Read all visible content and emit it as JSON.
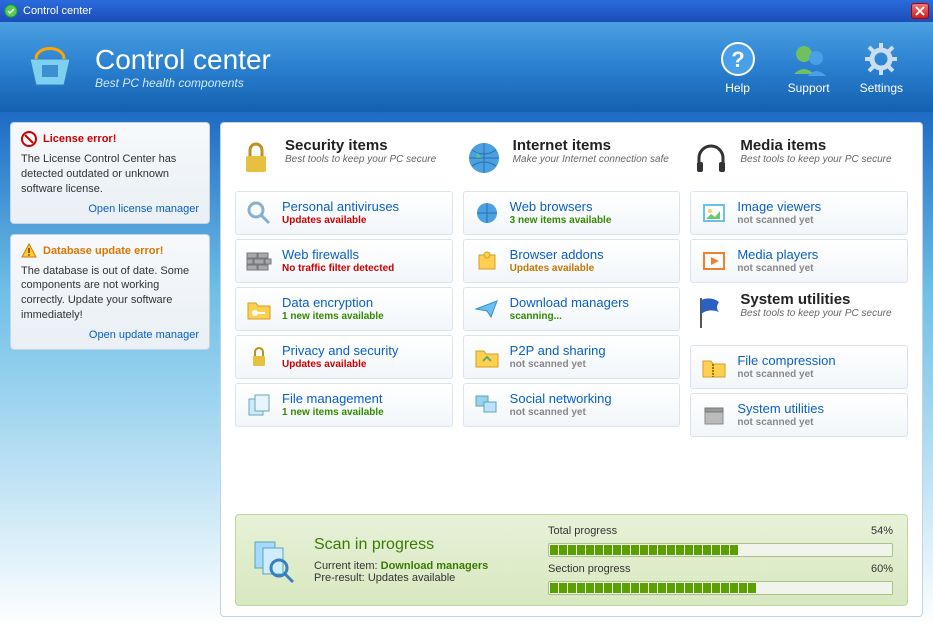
{
  "window": {
    "title": "Control center"
  },
  "header": {
    "title": "Control center",
    "subtitle": "Best PC health components",
    "nav": {
      "help": "Help",
      "support": "Support",
      "settings": "Settings"
    }
  },
  "alerts": {
    "license": {
      "title": "License error!",
      "body": "The License Control Center has detected outdated or unknown software license.",
      "link": "Open license manager"
    },
    "database": {
      "title": "Database update error!",
      "body": "The database is out of date. Some components are not working correctly. Update your software immediately!",
      "link": "Open update manager"
    }
  },
  "categories": {
    "security": {
      "title": "Security items",
      "desc": "Best tools to keep your PC secure"
    },
    "internet": {
      "title": "Internet items",
      "desc": "Make your Internet connection safe"
    },
    "media": {
      "title": "Media items",
      "desc": "Best tools to keep your PC secure"
    },
    "system": {
      "title": "System utilities",
      "desc": "Best tools to keep your PC secure"
    }
  },
  "tiles": {
    "antivirus": {
      "title": "Personal antiviruses",
      "status": "Updates available",
      "class": "st-red"
    },
    "firewall": {
      "title": "Web firewalls",
      "status": "No traffic filter detected",
      "class": "st-red"
    },
    "encrypt": {
      "title": "Data encryption",
      "status": "1 new items available",
      "class": "st-green"
    },
    "privacy": {
      "title": "Privacy and security",
      "status": "Updates available",
      "class": "st-red"
    },
    "files": {
      "title": "File management",
      "status": "1 new items available",
      "class": "st-green"
    },
    "browsers": {
      "title": "Web browsers",
      "status": "3 new items available",
      "class": "st-green"
    },
    "addons": {
      "title": "Browser addons",
      "status": "Updates available",
      "class": "st-orange"
    },
    "download": {
      "title": "Download managers",
      "status": "scanning...",
      "class": "st-green"
    },
    "p2p": {
      "title": "P2P and sharing",
      "status": "not scanned yet",
      "class": "st-gray"
    },
    "social": {
      "title": "Social networking",
      "status": "not scanned yet",
      "class": "st-gray"
    },
    "imgview": {
      "title": "Image viewers",
      "status": "not scanned yet",
      "class": "st-gray"
    },
    "mediaplay": {
      "title": "Media players",
      "status": "not scanned yet",
      "class": "st-gray"
    },
    "compress": {
      "title": "File compression",
      "status": "not scanned yet",
      "class": "st-gray"
    },
    "sysutil": {
      "title": "System utilities",
      "status": "not scanned yet",
      "class": "st-gray"
    }
  },
  "scan": {
    "title": "Scan in progress",
    "current_label": "Current item:",
    "current_value": "Download managers",
    "pre_label": "Pre-result:",
    "pre_value": "Updates available",
    "total_label": "Total progress",
    "total_pct": "54%",
    "total_pct_n": 54,
    "section_label": "Section progress",
    "section_pct": "60%",
    "section_pct_n": 60
  }
}
